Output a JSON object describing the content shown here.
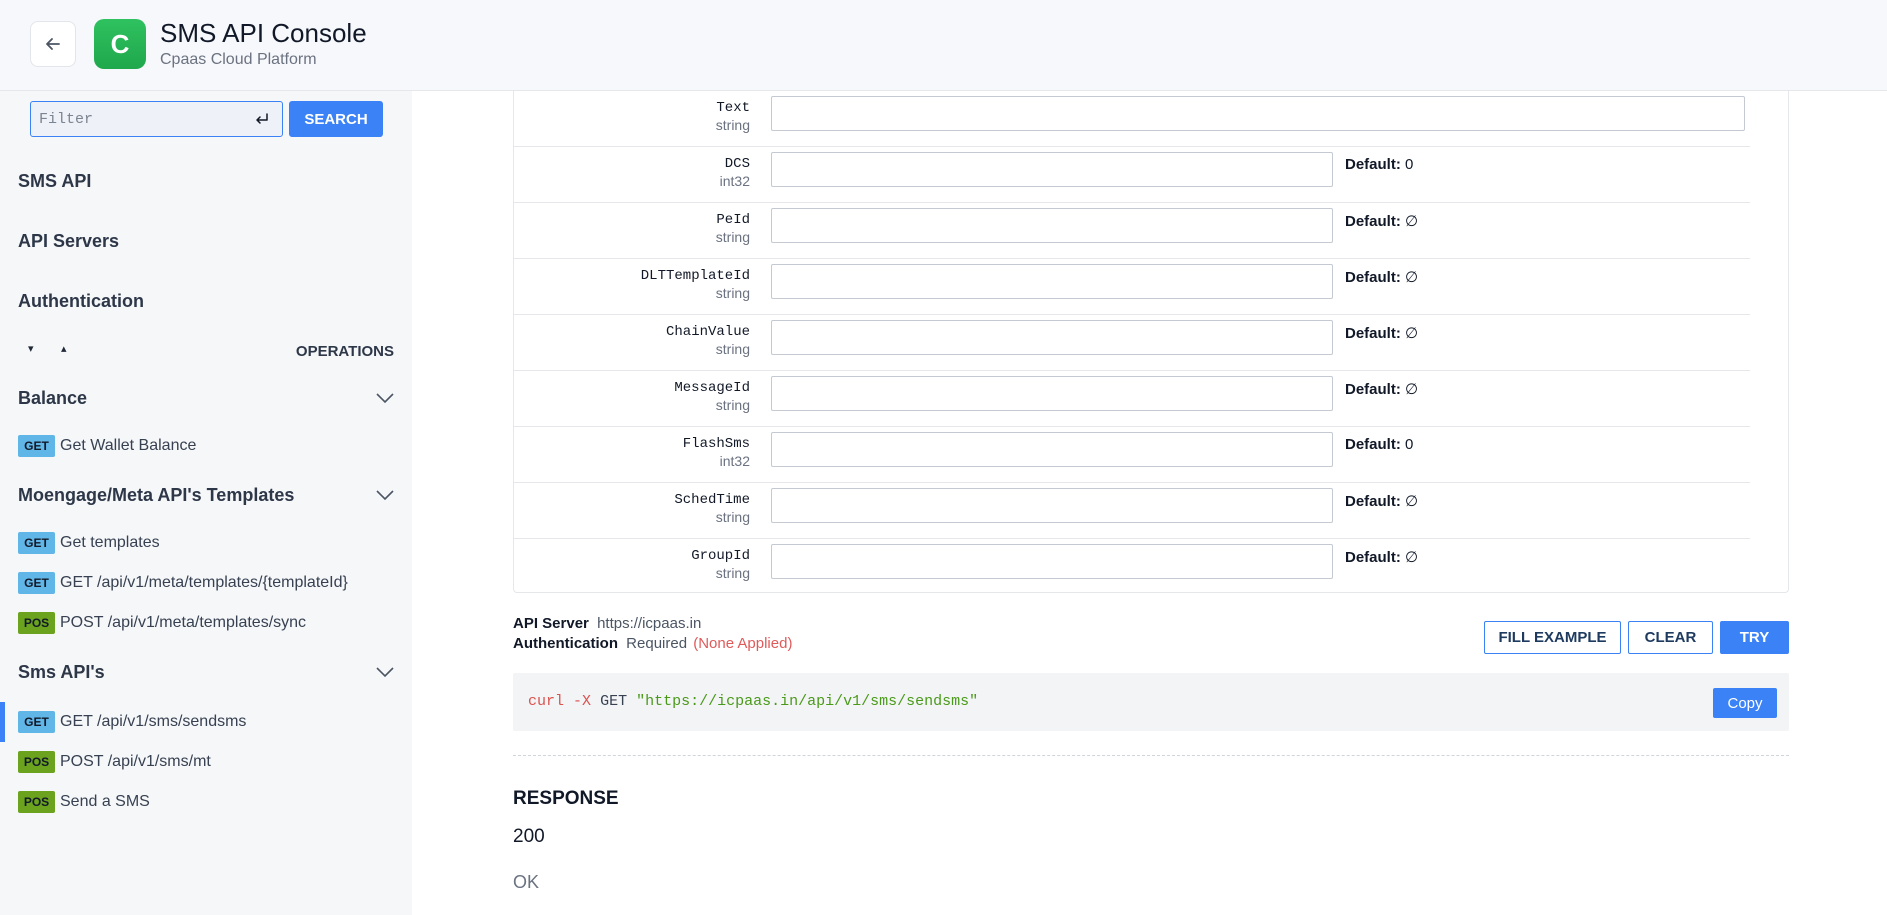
{
  "header": {
    "title": "SMS API Console",
    "subtitle": "Cpaas Cloud Platform",
    "logo_letter": "C",
    "brand_color": "#22b455"
  },
  "sidebar": {
    "filter_placeholder": "Filter",
    "search_label": "SEARCH",
    "nav": [
      "SMS API",
      "API Servers",
      "Authentication"
    ],
    "operations_label": "OPERATIONS",
    "expand_glyph": "▾",
    "collapse_glyph": "▴",
    "groups": [
      {
        "title": "Balance",
        "ops": [
          {
            "method": "GET",
            "label": "Get Wallet Balance"
          }
        ]
      },
      {
        "title": "Moengage/Meta API's Templates",
        "ops": [
          {
            "method": "GET",
            "label": "Get templates"
          },
          {
            "method": "GET",
            "label": "GET /api/v1/meta/templates/{templateId}"
          },
          {
            "method": "POS",
            "label": "POST /api/v1/meta/templates/sync"
          }
        ]
      },
      {
        "title": "Sms API's",
        "ops": [
          {
            "method": "GET",
            "label": "GET /api/v1/sms/sendsms",
            "active": true
          },
          {
            "method": "POS",
            "label": "POST /api/v1/sms/mt"
          },
          {
            "method": "POS",
            "label": "Send a SMS"
          }
        ]
      }
    ]
  },
  "params": [
    {
      "name": "Text",
      "type": "string",
      "default_label": "",
      "default_value": ""
    },
    {
      "name": "DCS",
      "type": "int32",
      "default_label": "Default:",
      "default_value": "0"
    },
    {
      "name": "PeId",
      "type": "string",
      "default_label": "Default:",
      "default_value": "∅"
    },
    {
      "name": "DLTTemplateId",
      "type": "string",
      "default_label": "Default:",
      "default_value": "∅"
    },
    {
      "name": "ChainValue",
      "type": "string",
      "default_label": "Default:",
      "default_value": "∅"
    },
    {
      "name": "MessageId",
      "type": "string",
      "default_label": "Default:",
      "default_value": "∅"
    },
    {
      "name": "FlashSms",
      "type": "int32",
      "default_label": "Default:",
      "default_value": "0"
    },
    {
      "name": "SchedTime",
      "type": "string",
      "default_label": "Default:",
      "default_value": "∅"
    },
    {
      "name": "GroupId",
      "type": "string",
      "default_label": "Default:",
      "default_value": "∅"
    }
  ],
  "request": {
    "server_label": "API Server",
    "server_value": "https://icpaas.in",
    "auth_label": "Authentication",
    "auth_value": "Required",
    "auth_status": "(None Applied)",
    "fill_example_label": "FILL EXAMPLE",
    "clear_label": "CLEAR",
    "try_label": "TRY"
  },
  "curl": {
    "cmd": "curl",
    "flag": "-X",
    "method": "GET",
    "url": "\"https://icpaas.in/api/v1/sms/sendsms\"",
    "copy_label": "Copy"
  },
  "response": {
    "title": "RESPONSE",
    "code": "200",
    "description": "OK"
  }
}
